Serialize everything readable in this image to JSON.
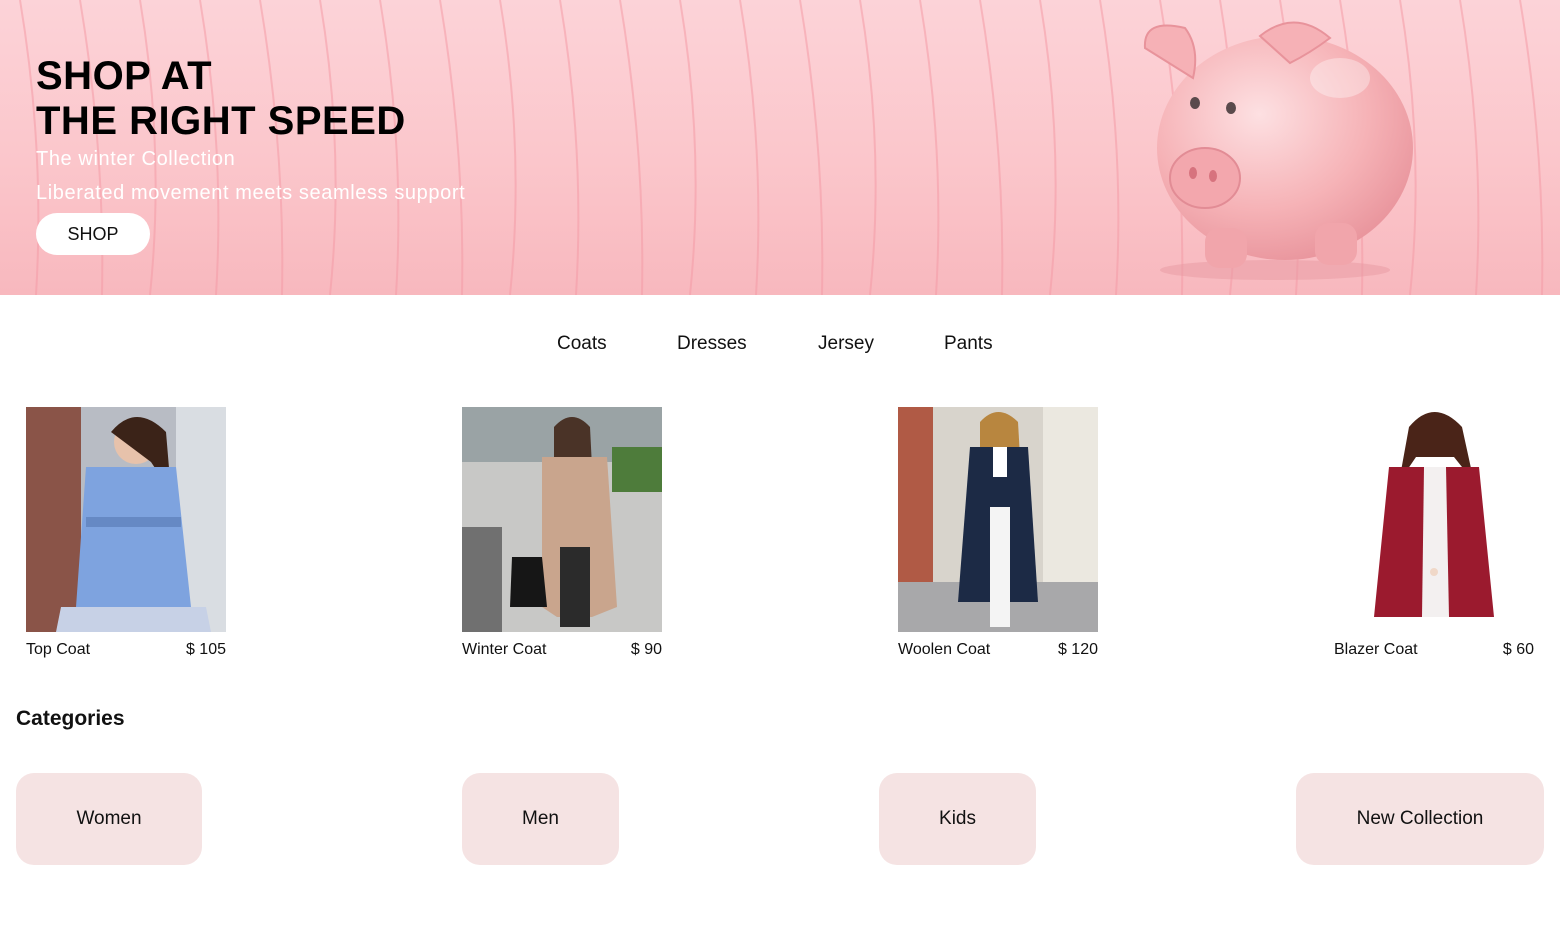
{
  "hero": {
    "title_line1": "SHOP AT",
    "title_line2": "THE RIGHT SPEED",
    "subtitle": "The winter Collection",
    "tagline": "Liberated movement meets seamless support",
    "button_label": "SHOP"
  },
  "nav": {
    "items": [
      {
        "label": "Coats"
      },
      {
        "label": "Dresses"
      },
      {
        "label": "Jersey"
      },
      {
        "label": "Pants"
      }
    ]
  },
  "products": [
    {
      "name": "Top Coat",
      "price": "$ 105",
      "color": "#7ea3df"
    },
    {
      "name": "Winter Coat",
      "price": "$ 90",
      "color": "#c9a58d"
    },
    {
      "name": "Woolen Coat",
      "price": "$ 120",
      "color": "#1c2a45"
    },
    {
      "name": "Blazer Coat",
      "price": "$ 60",
      "color": "#9b1a2e"
    }
  ],
  "categories": {
    "heading": "Categories",
    "items": [
      {
        "label": "Women"
      },
      {
        "label": "Men"
      },
      {
        "label": "Kids"
      },
      {
        "label": "New Collection"
      }
    ]
  },
  "colors": {
    "hero_bg": "#fbc6cb",
    "category_bg": "#f5e3e3"
  }
}
